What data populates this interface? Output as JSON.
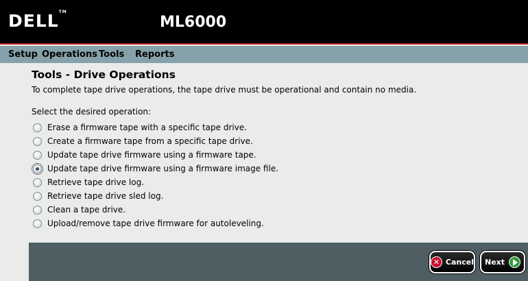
{
  "header": {
    "logo": "DELL",
    "trademark": "TM",
    "product": "ML6000"
  },
  "menu": [
    {
      "label": "Setup"
    },
    {
      "label": "Operations"
    },
    {
      "label": "Tools"
    },
    {
      "label": "Reports"
    }
  ],
  "page": {
    "title": "Tools - Drive Operations",
    "instruction": "To complete tape drive operations, the tape drive must be operational and contain no media.",
    "prompt": "Select the desired operation:"
  },
  "options": [
    {
      "label": "Erase a firmware tape with a specific tape drive.",
      "selected": false
    },
    {
      "label": "Create a firmware tape from a specific tape drive.",
      "selected": false
    },
    {
      "label": "Update tape drive firmware using a firmware tape.",
      "selected": false
    },
    {
      "label": "Update tape drive firmware using a firmware image file.",
      "selected": true
    },
    {
      "label": "Retrieve tape drive log.",
      "selected": false
    },
    {
      "label": "Retrieve tape drive sled log.",
      "selected": false
    },
    {
      "label": "Clean a tape drive.",
      "selected": false
    },
    {
      "label": "Upload/remove tape drive firmware for autoleveling.",
      "selected": false
    }
  ],
  "buttons": {
    "cancel": "Cancel",
    "next": "Next"
  },
  "colors": {
    "header_bg": "#000000",
    "accent_red": "#c41e23",
    "menubar_bg": "#87a1ab",
    "content_bg": "#e9ecea",
    "footer_bg": "#4e5e63"
  }
}
